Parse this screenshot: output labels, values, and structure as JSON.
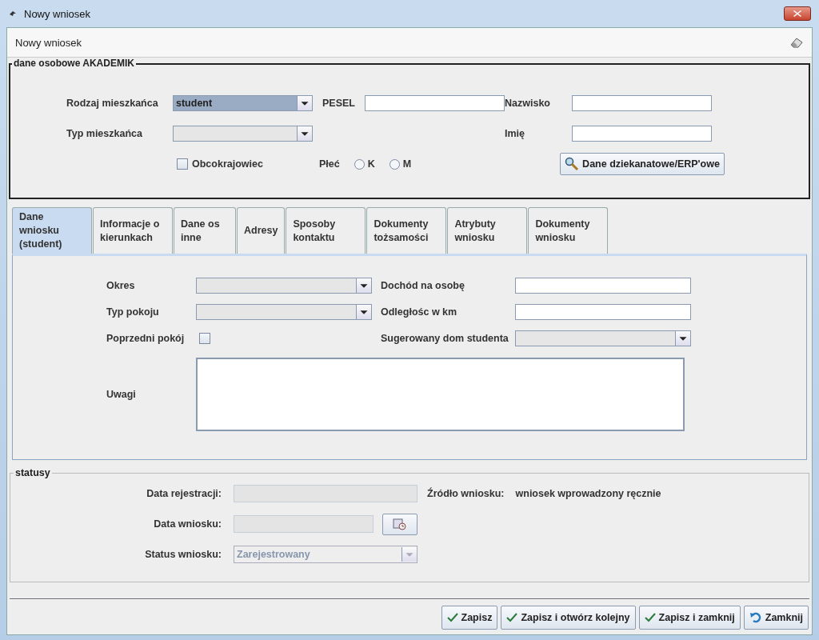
{
  "window": {
    "title": "Nowy wniosek"
  },
  "header": {
    "title": "Nowy wniosek"
  },
  "personal": {
    "legend": "dane osobowe AKADEMIK",
    "resident_kind": {
      "label": "Rodzaj mieszkańca",
      "value": "student"
    },
    "pesel": {
      "label": "PESEL"
    },
    "surname": {
      "label": "Nazwisko"
    },
    "resident_type": {
      "label": "Typ mieszkańca"
    },
    "first_name": {
      "label": "Imię"
    },
    "foreigner": {
      "label": "Obcokrajowiec",
      "checked": false
    },
    "sex": {
      "label": "Płeć",
      "options": [
        {
          "label": "K",
          "selected": false
        },
        {
          "label": "M",
          "selected": false
        }
      ]
    },
    "dean_button": "Dane dziekanatowe/ERP'owe"
  },
  "tabs": [
    {
      "label": "Dane wniosku (student)",
      "selected": true
    },
    {
      "label": "Informacje o kierunkach",
      "selected": false
    },
    {
      "label": "Dane os inne",
      "selected": false
    },
    {
      "label": "Adresy",
      "selected": false
    },
    {
      "label": "Sposoby kontaktu",
      "selected": false
    },
    {
      "label": "Dokumenty tożsamości",
      "selected": false
    },
    {
      "label": "Atrybuty wniosku",
      "selected": false
    },
    {
      "label": "Dokumenty wniosku",
      "selected": false
    }
  ],
  "tab_panel": {
    "period": {
      "label": "Okres"
    },
    "income": {
      "label": "Dochód na osobę"
    },
    "room_type": {
      "label": "Typ pokoju"
    },
    "distance": {
      "label": "Odległośc w km"
    },
    "previous_room": {
      "label": "Poprzedni pokój",
      "checked": false
    },
    "suggested_dorm": {
      "label": "Sugerowany dom studenta"
    },
    "notes": {
      "label": "Uwagi"
    }
  },
  "statuses": {
    "legend": "statusy",
    "registration_date": {
      "label": "Data rejestracji:",
      "disabled": true
    },
    "source": {
      "label": "Źródło wniosku:",
      "value": "wniosek wprowadzony ręcznie"
    },
    "application_date": {
      "label": "Data wniosku:",
      "disabled": true
    },
    "status": {
      "label": "Status wniosku:",
      "value": "Zarejestrowany",
      "disabled": true
    }
  },
  "buttons": [
    {
      "label": "Zapisz",
      "kind": "save"
    },
    {
      "label": "Zapisz i otwórz kolejny",
      "kind": "save"
    },
    {
      "label": "Zapisz i zamknij",
      "kind": "save"
    },
    {
      "label": "Zamknij",
      "kind": "close"
    }
  ]
}
